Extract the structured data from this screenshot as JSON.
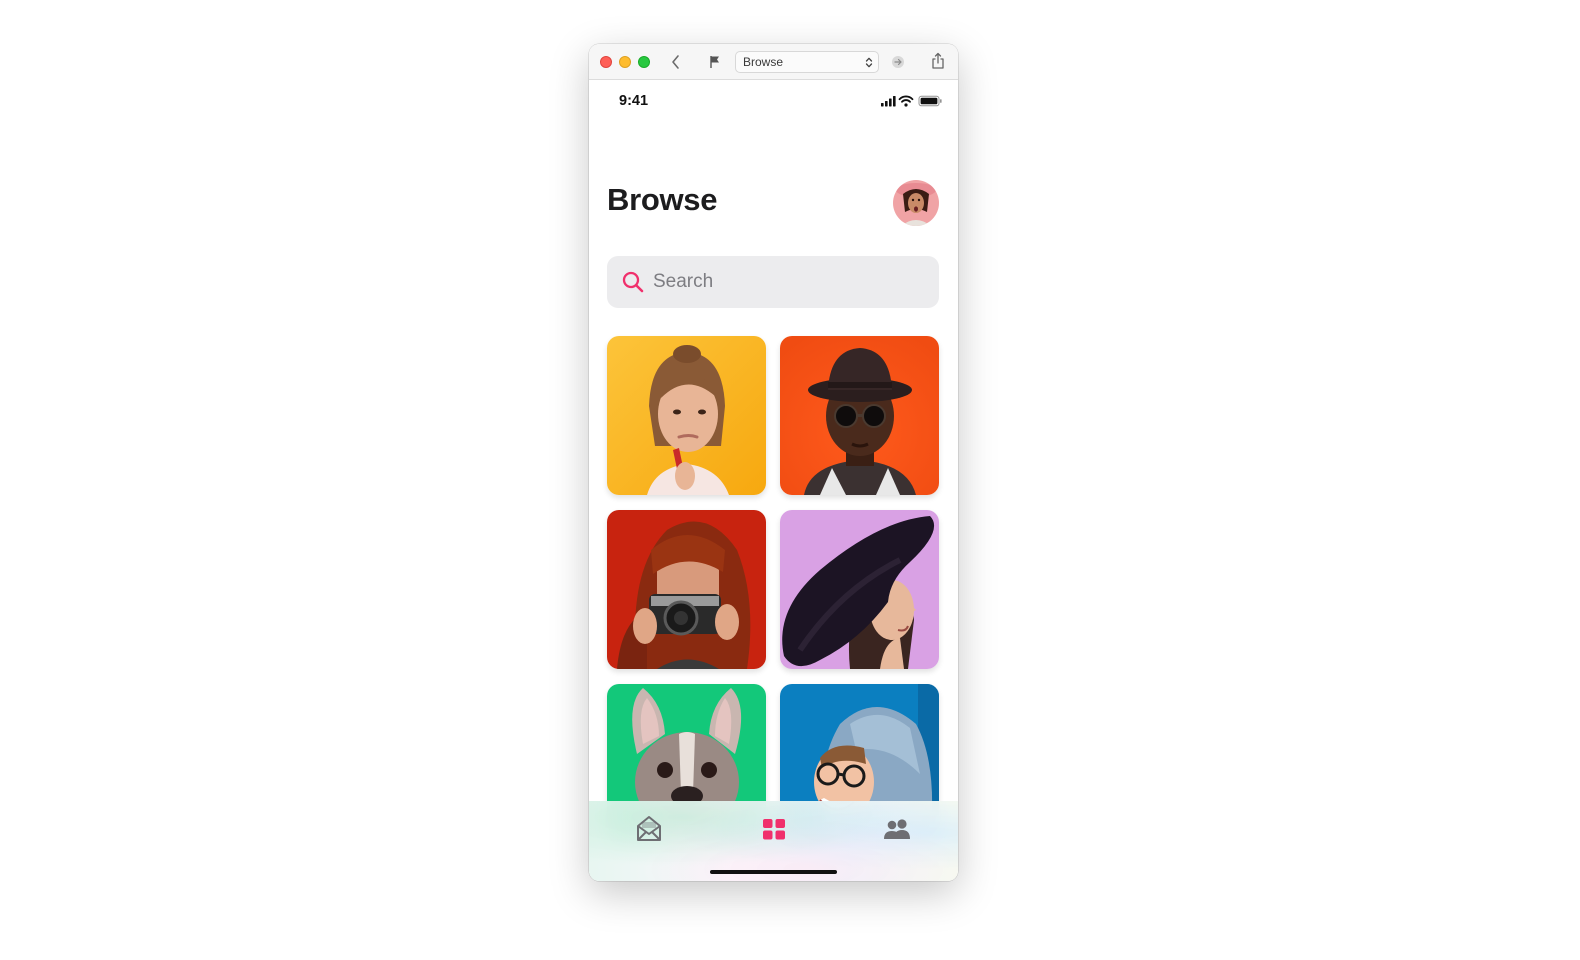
{
  "window": {
    "title_select": "Browse"
  },
  "status_bar": {
    "time": "9:41"
  },
  "header": {
    "title": "Browse"
  },
  "search": {
    "placeholder": "Search",
    "value": ""
  },
  "grid": {
    "tiles": [
      {
        "subject": "woman-thinking-portrait",
        "background": "#fbb421"
      },
      {
        "subject": "man-hat-sunglasses-portrait",
        "background": "#f2561a"
      },
      {
        "subject": "woman-camera-portrait",
        "background": "#c8230f"
      },
      {
        "subject": "woman-hat-profile-portrait",
        "background": "#d9a1e4"
      },
      {
        "subject": "french-bulldog-portrait",
        "background": "#13c87a"
      },
      {
        "subject": "woman-beanie-glasses-portrait",
        "background": "#0b7fc0"
      }
    ]
  },
  "tab_bar": {
    "tabs": [
      {
        "icon": "envelope-open-icon",
        "active": false
      },
      {
        "icon": "grid-icon",
        "active": true
      },
      {
        "icon": "people-icon",
        "active": false
      }
    ]
  },
  "colors": {
    "accent": "#f0306c",
    "inactive_icon": "#6e6e73"
  }
}
